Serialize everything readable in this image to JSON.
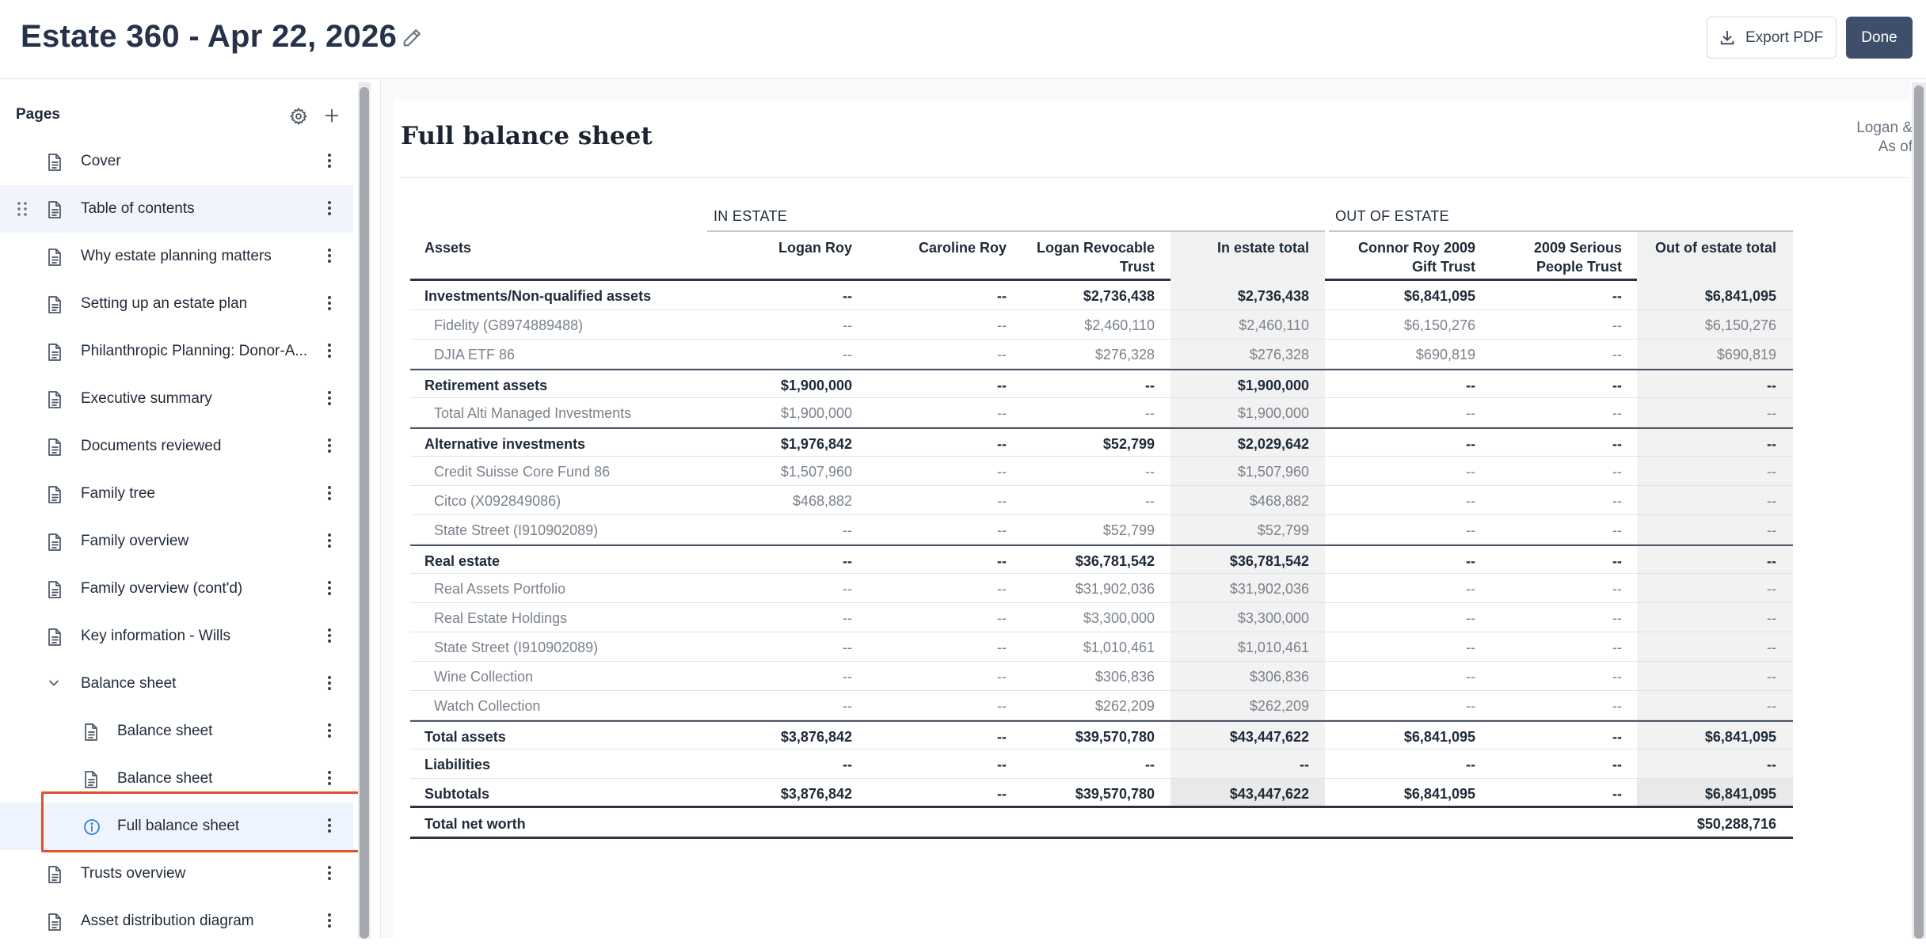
{
  "app": {
    "title": "Estate 360 - Apr 22, 2026",
    "export_label": "Export PDF",
    "done_label": "Done"
  },
  "sidebar": {
    "heading": "Pages",
    "items": [
      {
        "label": "Cover",
        "indent": 0,
        "icon": "document-icon"
      },
      {
        "label": "Table of contents",
        "indent": 0,
        "icon": "document-icon",
        "hovered": true
      },
      {
        "label": "Why estate planning matters",
        "indent": 0,
        "icon": "document-icon"
      },
      {
        "label": "Setting up an estate plan",
        "indent": 0,
        "icon": "document-icon"
      },
      {
        "label": "Philanthropic Planning: Donor-A...",
        "indent": 0,
        "icon": "document-icon"
      },
      {
        "label": "Executive summary",
        "indent": 0,
        "icon": "document-icon"
      },
      {
        "label": "Documents reviewed",
        "indent": 0,
        "icon": "document-icon"
      },
      {
        "label": "Family tree",
        "indent": 0,
        "icon": "document-icon"
      },
      {
        "label": "Family overview",
        "indent": 0,
        "icon": "document-icon"
      },
      {
        "label": "Family overview (cont'd)",
        "indent": 0,
        "icon": "document-icon"
      },
      {
        "label": "Key information - Wills",
        "indent": 0,
        "icon": "document-icon"
      },
      {
        "label": "Balance sheet",
        "indent": 0,
        "icon": "chevron-down-icon"
      },
      {
        "label": "Balance sheet",
        "indent": 1,
        "icon": "document-icon"
      },
      {
        "label": "Balance sheet",
        "indent": 1,
        "icon": "document-icon"
      },
      {
        "label": "Full balance sheet",
        "indent": 1,
        "icon": "info-icon",
        "active": true
      },
      {
        "label": "Trusts overview",
        "indent": 0,
        "icon": "document-icon"
      },
      {
        "label": "Asset distribution diagram",
        "indent": 0,
        "icon": "document-icon"
      }
    ]
  },
  "sheet": {
    "title": "Full balance sheet",
    "meta_line1": "Logan &",
    "meta_line2": "As of"
  },
  "table": {
    "group_in": "IN ESTATE",
    "group_out": "OUT OF ESTATE",
    "headers": [
      "Assets",
      "Logan Roy",
      "Caroline Roy",
      "Logan Revocable Trust",
      "In estate total",
      "Connor Roy 2009 Gift Trust",
      "2009 Serious People Trust",
      "Out of estate total"
    ],
    "headers_wrapped": [
      [
        "Assets"
      ],
      [
        "Logan Roy"
      ],
      [
        "Caroline Roy"
      ],
      [
        "Logan Revocable",
        "Trust"
      ],
      [
        "In estate total"
      ],
      [
        "Connor Roy 2009",
        "Gift Trust"
      ],
      [
        "2009 Serious",
        "People Trust"
      ],
      [
        "Out of estate total"
      ]
    ],
    "rows": [
      {
        "type": "bold",
        "sep": true,
        "cells": [
          "Investments/Non-qualified assets",
          "--",
          "--",
          "$2,736,438",
          "$2,736,438",
          "$6,841,095",
          "--",
          "$6,841,095"
        ]
      },
      {
        "type": "sub",
        "cells": [
          "Fidelity (G8974889488)",
          "--",
          "--",
          "$2,460,110",
          "$2,460,110",
          "$6,150,276",
          "--",
          "$6,150,276"
        ]
      },
      {
        "type": "sub",
        "cells": [
          "DJIA ETF 86",
          "--",
          "--",
          "$276,328",
          "$276,328",
          "$690,819",
          "--",
          "$690,819"
        ]
      },
      {
        "type": "bold",
        "sep": true,
        "cells": [
          "Retirement assets",
          "$1,900,000",
          "--",
          "--",
          "$1,900,000",
          "--",
          "--",
          "--"
        ]
      },
      {
        "type": "sub",
        "cells": [
          "Total Alti Managed Investments",
          "$1,900,000",
          "--",
          "--",
          "$1,900,000",
          "--",
          "--",
          "--"
        ]
      },
      {
        "type": "bold",
        "sep": true,
        "cells": [
          "Alternative investments",
          "$1,976,842",
          "--",
          "$52,799",
          "$2,029,642",
          "--",
          "--",
          "--"
        ]
      },
      {
        "type": "sub",
        "cells": [
          "Credit Suisse Core Fund 86",
          "$1,507,960",
          "--",
          "--",
          "$1,507,960",
          "--",
          "--",
          "--"
        ]
      },
      {
        "type": "sub",
        "cells": [
          "Citco (X092849086)",
          "$468,882",
          "--",
          "--",
          "$468,882",
          "--",
          "--",
          "--"
        ]
      },
      {
        "type": "sub",
        "cells": [
          "State Street (I910902089)",
          "--",
          "--",
          "$52,799",
          "$52,799",
          "--",
          "--",
          "--"
        ]
      },
      {
        "type": "bold",
        "sep": true,
        "cells": [
          "Real estate",
          "--",
          "--",
          "$36,781,542",
          "$36,781,542",
          "--",
          "--",
          "--"
        ]
      },
      {
        "type": "sub",
        "cells": [
          "Real Assets Portfolio",
          "--",
          "--",
          "$31,902,036",
          "$31,902,036",
          "--",
          "--",
          "--"
        ]
      },
      {
        "type": "sub",
        "cells": [
          "Real Estate Holdings",
          "--",
          "--",
          "$3,300,000",
          "$3,300,000",
          "--",
          "--",
          "--"
        ]
      },
      {
        "type": "sub",
        "cells": [
          "State Street (I910902089)",
          "--",
          "--",
          "$1,010,461",
          "$1,010,461",
          "--",
          "--",
          "--"
        ]
      },
      {
        "type": "sub",
        "cells": [
          "Wine Collection",
          "--",
          "--",
          "$306,836",
          "$306,836",
          "--",
          "--",
          "--"
        ]
      },
      {
        "type": "sub",
        "cells": [
          "Watch Collection",
          "--",
          "--",
          "$262,209",
          "$262,209",
          "--",
          "--",
          "--"
        ]
      },
      {
        "type": "bold",
        "sep": true,
        "cells": [
          "Total assets",
          "$3,876,842",
          "--",
          "$39,570,780",
          "$43,447,622",
          "$6,841,095",
          "--",
          "$6,841,095"
        ]
      },
      {
        "type": "bold",
        "cells": [
          "Liabilities",
          "--",
          "--",
          "--",
          "--",
          "--",
          "--",
          "--"
        ]
      },
      {
        "type": "bold",
        "subtotal": true,
        "cells": [
          "Subtotals",
          "$3,876,842",
          "--",
          "$39,570,780",
          "$43,447,622",
          "$6,841,095",
          "--",
          "$6,841,095"
        ]
      }
    ],
    "net_worth_label": "Total net worth",
    "net_worth_value": "$50,288,716"
  }
}
